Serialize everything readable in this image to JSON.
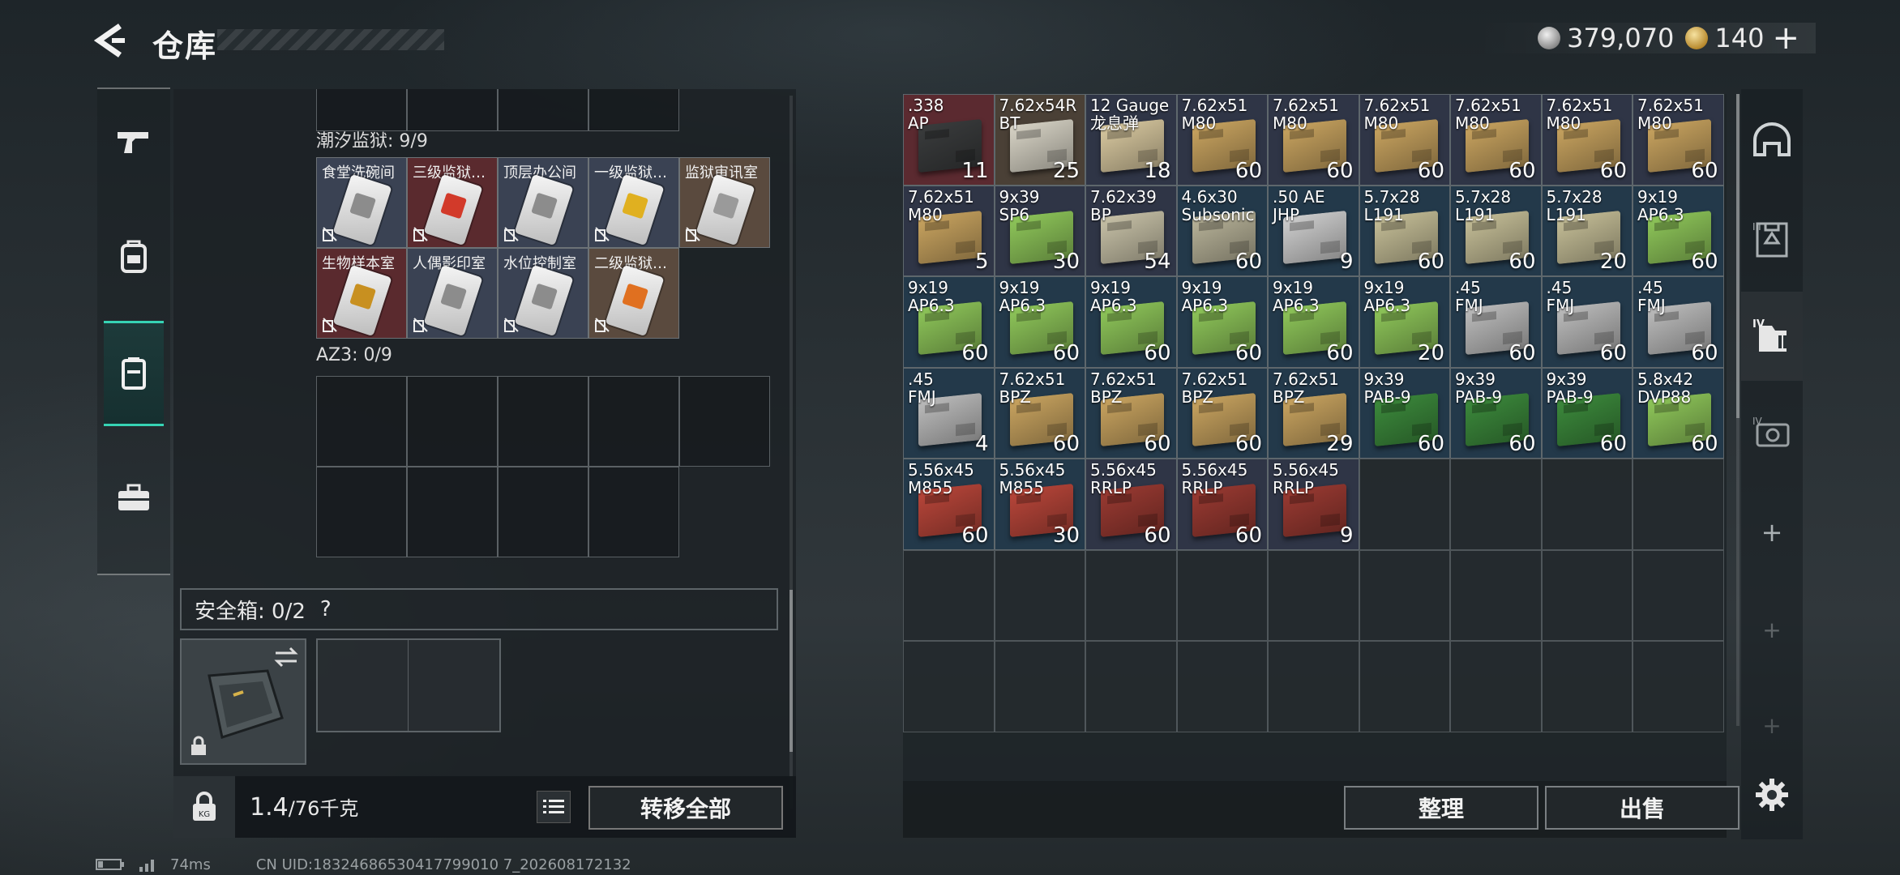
{
  "header": {
    "title": "仓库",
    "currencies": [
      {
        "icon": "silver-coin-icon",
        "value": "379,070"
      },
      {
        "icon": "gold-coin-icon",
        "value": "140"
      }
    ],
    "add_label": "+"
  },
  "left_nav": [
    "pistol-icon",
    "backpack-icon",
    "container-icon",
    "briefcase-icon"
  ],
  "left_panel": {
    "sections": [
      {
        "title": "潮汐监狱: 9/9",
        "items": [
          {
            "name": "食堂洗碗间",
            "stripe": "#8c8c8c",
            "bg": "#3a4253"
          },
          {
            "name": "三级监狱…",
            "stripe": "#d23a2a",
            "bg": "#5a2a2e"
          },
          {
            "name": "顶层办公间",
            "stripe": "#8c8c8c",
            "bg": "#3a4253"
          },
          {
            "name": "一级监狱…",
            "stripe": "#e0b020",
            "bg": "#3a4253"
          },
          {
            "name": "监狱审讯室",
            "stripe": "#9a9a9a",
            "bg": "#5a4a3e"
          },
          {
            "name": "生物样本室",
            "stripe": "#c89020",
            "bg": "#5a2a2e"
          },
          {
            "name": "人偶影印室",
            "stripe": "#8c8c8c",
            "bg": "#3a4253"
          },
          {
            "name": "水位控制室",
            "stripe": "#8c8c8c",
            "bg": "#3a4253"
          },
          {
            "name": "二级监狱…",
            "stripe": "#e07020",
            "bg": "#5a4a3e"
          }
        ]
      },
      {
        "title": "AZ3: 0/9"
      }
    ],
    "safe_box": {
      "label": "安全箱: 0/2",
      "help": "?"
    },
    "footer": {
      "weight_current": "1.4",
      "weight_max": "/76千克",
      "transfer_all": "转移全部"
    }
  },
  "stash": {
    "items": [
      {
        "name": ".338\nAP",
        "qty": "11",
        "color": "#3a3c3d",
        "bg": "#5b2a30"
      },
      {
        "name": "7.62x54R\nBT",
        "qty": "25",
        "color": "#d8d4c6",
        "bg": "#4a4036"
      },
      {
        "name": "12 Gauge\n龙息弹",
        "qty": "18",
        "color": "#d9c9a0",
        "bg": "#2f3546"
      },
      {
        "name": "7.62x51\nM80",
        "qty": "60",
        "color": "#c9a460",
        "bg": "#2f3546"
      },
      {
        "name": "7.62x51\nM80",
        "qty": "60",
        "color": "#c9a460",
        "bg": "#2f3546"
      },
      {
        "name": "7.62x51\nM80",
        "qty": "60",
        "color": "#c9a460",
        "bg": "#2f3546"
      },
      {
        "name": "7.62x51\nM80",
        "qty": "60",
        "color": "#c9a460",
        "bg": "#2f3546"
      },
      {
        "name": "7.62x51\nM80",
        "qty": "60",
        "color": "#c9a460",
        "bg": "#2f3546"
      },
      {
        "name": "7.62x51\nM80",
        "qty": "60",
        "color": "#c9a460",
        "bg": "#2f3546"
      },
      {
        "name": "7.62x51\nM80",
        "qty": "5",
        "color": "#c9a460",
        "bg": "#2f3546"
      },
      {
        "name": "9x39\nSP6",
        "qty": "30",
        "color": "#8fc75a",
        "bg": "#2f3546"
      },
      {
        "name": "7.62x39\nBP",
        "qty": "54",
        "color": "#c8c2a8",
        "bg": "#2f3546"
      },
      {
        "name": "4.6x30\nSubsonic",
        "qty": "60",
        "color": "#b9b49a",
        "bg": "#23394a"
      },
      {
        "name": ".50 AE\nJHP",
        "qty": "9",
        "color": "#d0d0d0",
        "bg": "#23394a"
      },
      {
        "name": "5.7x28\nL191",
        "qty": "60",
        "color": "#c6bf98",
        "bg": "#23394a"
      },
      {
        "name": "5.7x28\nL191",
        "qty": "60",
        "color": "#c6bf98",
        "bg": "#23394a"
      },
      {
        "name": "5.7x28\nL191",
        "qty": "20",
        "color": "#c6bf98",
        "bg": "#23394a"
      },
      {
        "name": "9x19\nAP6.3",
        "qty": "60",
        "color": "#8fc75a",
        "bg": "#23394a"
      },
      {
        "name": "9x19\nAP6.3",
        "qty": "60",
        "color": "#8fc75a",
        "bg": "#23394a"
      },
      {
        "name": "9x19\nAP6.3",
        "qty": "60",
        "color": "#8fc75a",
        "bg": "#23394a"
      },
      {
        "name": "9x19\nAP6.3",
        "qty": "60",
        "color": "#8fc75a",
        "bg": "#23394a"
      },
      {
        "name": "9x19\nAP6.3",
        "qty": "60",
        "color": "#8fc75a",
        "bg": "#23394a"
      },
      {
        "name": "9x19\nAP6.3",
        "qty": "60",
        "color": "#8fc75a",
        "bg": "#23394a"
      },
      {
        "name": "9x19\nAP6.3",
        "qty": "20",
        "color": "#8fc75a",
        "bg": "#23394a"
      },
      {
        "name": ".45\nFMJ",
        "qty": "60",
        "color": "#bdbdbd",
        "bg": "#23394a"
      },
      {
        "name": ".45\nFMJ",
        "qty": "60",
        "color": "#bdbdbd",
        "bg": "#23394a"
      },
      {
        "name": ".45\nFMJ",
        "qty": "60",
        "color": "#bdbdbd",
        "bg": "#23394a"
      },
      {
        "name": ".45\nFMJ",
        "qty": "4",
        "color": "#bdbdbd",
        "bg": "#23394a"
      },
      {
        "name": "7.62x51\nBPZ",
        "qty": "60",
        "color": "#c9a460",
        "bg": "#23394a"
      },
      {
        "name": "7.62x51\nBPZ",
        "qty": "60",
        "color": "#c9a460",
        "bg": "#23394a"
      },
      {
        "name": "7.62x51\nBPZ",
        "qty": "60",
        "color": "#c9a460",
        "bg": "#23394a"
      },
      {
        "name": "7.62x51\nBPZ",
        "qty": "29",
        "color": "#c9a460",
        "bg": "#23394a"
      },
      {
        "name": "9x39\nPAB-9",
        "qty": "60",
        "color": "#3c8a3c",
        "bg": "#23394a"
      },
      {
        "name": "9x39\nPAB-9",
        "qty": "60",
        "color": "#3c8a3c",
        "bg": "#23394a"
      },
      {
        "name": "9x39\nPAB-9",
        "qty": "60",
        "color": "#3c8a3c",
        "bg": "#23394a"
      },
      {
        "name": "5.8x42\nDVP88",
        "qty": "60",
        "color": "#8fc75a",
        "bg": "#23394a"
      },
      {
        "name": "5.56x45\nM855",
        "qty": "60",
        "color": "#b9463a",
        "bg": "#23394a"
      },
      {
        "name": "5.56x45\nM855",
        "qty": "30",
        "color": "#b9463a",
        "bg": "#23394a"
      },
      {
        "name": "5.56x45\nRRLP",
        "qty": "60",
        "color": "#9a3a32",
        "bg": "#2f3546"
      },
      {
        "name": "5.56x45\nRRLP",
        "qty": "60",
        "color": "#9a3a32",
        "bg": "#2f3546"
      },
      {
        "name": "5.56x45\nRRLP",
        "qty": "9",
        "color": "#9a3a32",
        "bg": "#2f3546"
      }
    ],
    "footer": {
      "sort": "整理",
      "sell": "出售"
    }
  },
  "right_nav": [
    "helmet-icon",
    "armor-iii-icon",
    "container-iv-icon",
    "key-case-iv-icon",
    "add-slot-icon",
    "add-slot-icon",
    "add-slot-icon",
    "settings-icon"
  ],
  "status": {
    "ping": "74ms",
    "uid": "CN UID:18324686530417799010 7_202608172132"
  }
}
